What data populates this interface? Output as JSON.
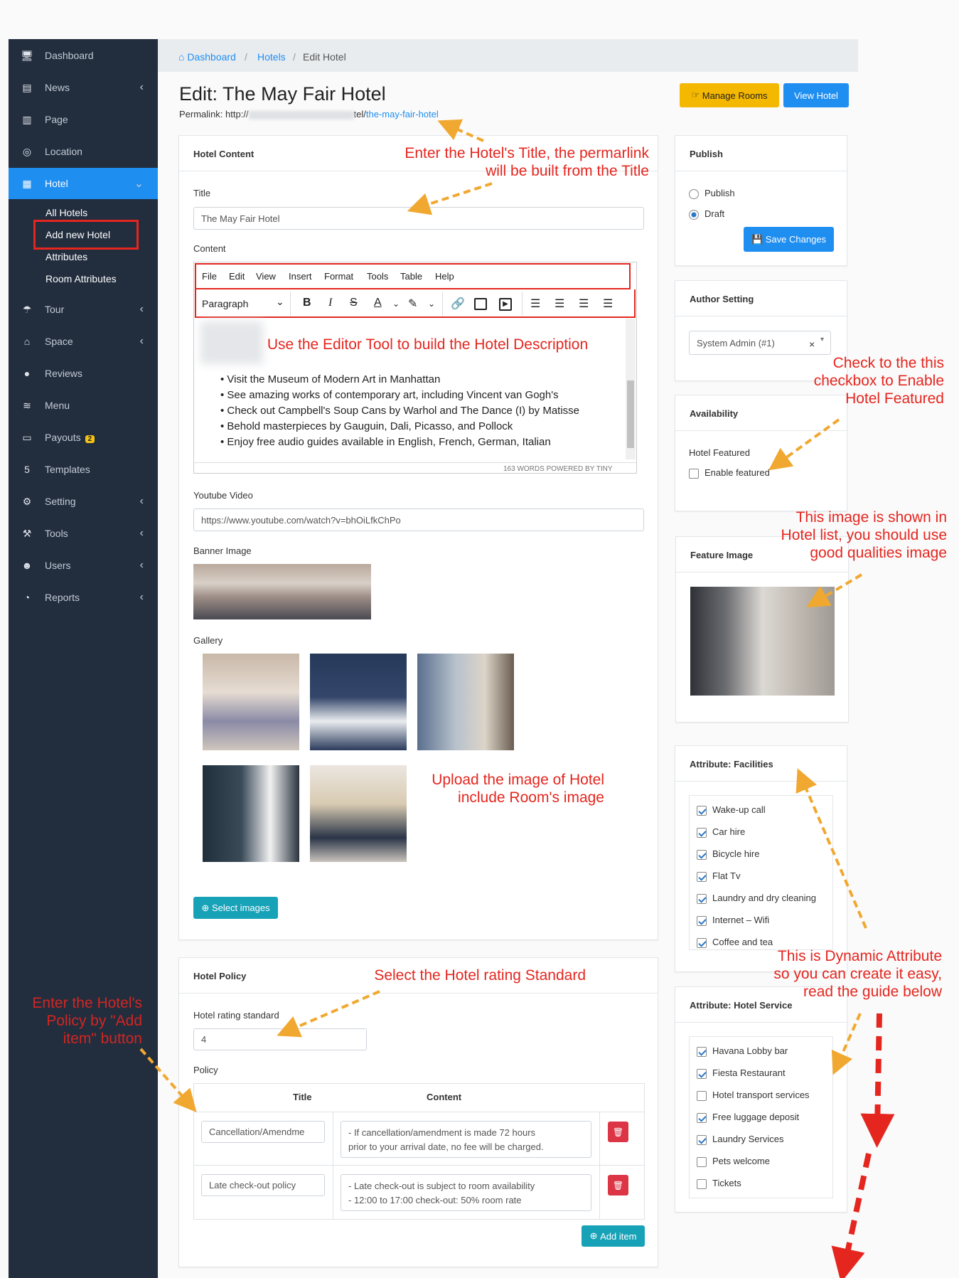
{
  "sidebar": {
    "items": [
      {
        "label": "Dashboard",
        "icon": "monitor-icon",
        "chevron": false
      },
      {
        "label": "News",
        "icon": "newspaper-icon",
        "chevron": true
      },
      {
        "label": "Page",
        "icon": "book-icon",
        "chevron": false
      },
      {
        "label": "Location",
        "icon": "compass-icon",
        "chevron": false
      },
      {
        "label": "Hotel",
        "icon": "building-icon",
        "chevron": true,
        "active": true
      },
      {
        "label": "Tour",
        "icon": "umbrella-icon",
        "chevron": true
      },
      {
        "label": "Space",
        "icon": "home-icon",
        "chevron": true
      },
      {
        "label": "Reviews",
        "icon": "comment-icon",
        "chevron": false
      },
      {
        "label": "Menu",
        "icon": "layers-icon",
        "chevron": false
      },
      {
        "label": "Payouts",
        "icon": "credit-card-icon",
        "chevron": false,
        "badge": "2"
      },
      {
        "label": "Templates",
        "icon": "html5-icon",
        "chevron": false
      },
      {
        "label": "Setting",
        "icon": "gear-icon",
        "chevron": true
      },
      {
        "label": "Tools",
        "icon": "hammer-icon",
        "chevron": true
      },
      {
        "label": "Users",
        "icon": "users-icon",
        "chevron": true
      },
      {
        "label": "Reports",
        "icon": "pie-chart-icon",
        "chevron": true
      }
    ],
    "hotel_sub": [
      "All Hotels",
      "Add new Hotel",
      "Attributes",
      "Room Attributes"
    ]
  },
  "breadcrumb": {
    "home": "Dashboard",
    "sep": "/",
    "hotels": "Hotels",
    "current": "Edit Hotel"
  },
  "page": {
    "title": "Edit: The May Fair Hotel",
    "permalink_label": "Permalink: http://",
    "permalink_mid": "tel/",
    "permalink_slug": "the-may-fair-hotel",
    "manage_rooms": "Manage Rooms",
    "view_hotel": "View Hotel"
  },
  "content_card": {
    "header": "Hotel Content",
    "title_label": "Title",
    "title_value": "The May Fair Hotel",
    "content_label": "Content",
    "menu": [
      "File",
      "Edit",
      "View",
      "Insert",
      "Format",
      "Tools",
      "Table",
      "Help"
    ],
    "block_format": "Paragraph",
    "bullets": [
      "Visit the Museum of Modern Art in Manhattan",
      "See amazing works of contemporary art, including Vincent van Gogh's",
      "Check out Campbell's Soup Cans by Warhol and The Dance (I) by Matisse",
      "Behold masterpieces by Gauguin, Dali, Picasso, and Pollock",
      "Enjoy free audio guides available in English, French, German, Italian"
    ],
    "status": "163 WORDS  POWERED BY TINY",
    "youtube_label": "Youtube Video",
    "youtube_value": "https://www.youtube.com/watch?v=bhOiLfkChPo",
    "banner_label": "Banner Image",
    "gallery_label": "Gallery",
    "select_images": "Select images"
  },
  "policy_card": {
    "header": "Hotel Policy",
    "rating_label": "Hotel rating standard",
    "rating_value": "4",
    "policy_label": "Policy",
    "col_title": "Title",
    "col_content": "Content",
    "rows": [
      {
        "title": "Cancellation/Amendme",
        "content1": "- If cancellation/amendment is made 72 hours",
        "content2": "prior to your arrival date, no fee will be charged."
      },
      {
        "title": "Late check-out policy",
        "content1": "- Late check-out is subject to room availability",
        "content2": "- 12:00 to 17:00 check-out: 50% room rate"
      }
    ],
    "add_item": "Add item"
  },
  "publish_card": {
    "header": "Publish",
    "publish": "Publish",
    "draft": "Draft",
    "selected": "Draft",
    "save": "Save Changes"
  },
  "author_card": {
    "header": "Author Setting",
    "value": "System Admin (#1)",
    "clear": "×"
  },
  "availability_card": {
    "header": "Availability",
    "featured_label": "Hotel Featured",
    "enable": "Enable featured",
    "checked": false
  },
  "feature_card": {
    "header": "Feature Image"
  },
  "facilities_card": {
    "header": "Attribute: Facilities",
    "items": [
      {
        "label": "Wake-up call",
        "checked": true
      },
      {
        "label": "Car hire",
        "checked": true
      },
      {
        "label": "Bicycle hire",
        "checked": true
      },
      {
        "label": "Flat Tv",
        "checked": true
      },
      {
        "label": "Laundry and dry cleaning",
        "checked": true
      },
      {
        "label": "Internet – Wifi",
        "checked": true
      },
      {
        "label": "Coffee and tea",
        "checked": true
      }
    ]
  },
  "service_card": {
    "header": "Attribute: Hotel Service",
    "items": [
      {
        "label": "Havana Lobby bar",
        "checked": true
      },
      {
        "label": "Fiesta Restaurant",
        "checked": true
      },
      {
        "label": "Hotel transport services",
        "checked": false
      },
      {
        "label": "Free luggage deposit",
        "checked": true
      },
      {
        "label": "Laundry Services",
        "checked": true
      },
      {
        "label": "Pets welcome",
        "checked": false
      },
      {
        "label": "Tickets",
        "checked": false
      }
    ]
  },
  "annotations": {
    "title1": "Enter the Hotel's Title, the permarlink",
    "title2": "will be built from the Title",
    "editor": "Use the Editor Tool to build the Hotel Description",
    "gallery1": "Upload the image of Hotel",
    "gallery2": "include Room's image",
    "rating": "Select the Hotel rating Standard",
    "policy1": "Enter the Hotel's",
    "policy2": "Policy  by \"Add",
    "policy3": "item\" button",
    "featured1": "Check to the this",
    "featured2": "checkbox to Enable",
    "featured3": "Hotel Featured",
    "image1": "This image is shown in",
    "image2": "Hotel list, you should use",
    "image3": "good qualities image",
    "dynamic1": "This is Dynamic Attribute",
    "dynamic2": "so you can create it easy,",
    "dynamic3": "read the guide below"
  },
  "colors": {
    "sidebar": "#222d3e",
    "active": "#1f8ef1",
    "annotation": "#e4261f",
    "arrow": "#f0a830",
    "warning": "#f5b800",
    "info": "#17a2b8",
    "danger": "#dc3545"
  }
}
